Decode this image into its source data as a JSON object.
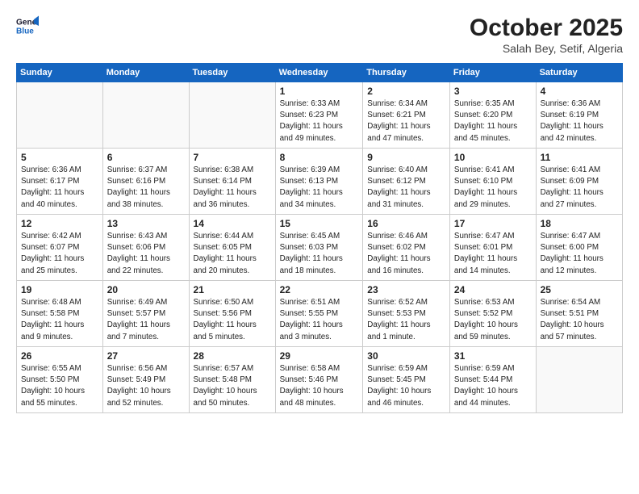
{
  "header": {
    "logo_line1": "General",
    "logo_line2": "Blue",
    "month": "October 2025",
    "location": "Salah Bey, Setif, Algeria"
  },
  "weekdays": [
    "Sunday",
    "Monday",
    "Tuesday",
    "Wednesday",
    "Thursday",
    "Friday",
    "Saturday"
  ],
  "weeks": [
    [
      {
        "day": "",
        "info": ""
      },
      {
        "day": "",
        "info": ""
      },
      {
        "day": "",
        "info": ""
      },
      {
        "day": "1",
        "info": "Sunrise: 6:33 AM\nSunset: 6:23 PM\nDaylight: 11 hours\nand 49 minutes."
      },
      {
        "day": "2",
        "info": "Sunrise: 6:34 AM\nSunset: 6:21 PM\nDaylight: 11 hours\nand 47 minutes."
      },
      {
        "day": "3",
        "info": "Sunrise: 6:35 AM\nSunset: 6:20 PM\nDaylight: 11 hours\nand 45 minutes."
      },
      {
        "day": "4",
        "info": "Sunrise: 6:36 AM\nSunset: 6:19 PM\nDaylight: 11 hours\nand 42 minutes."
      }
    ],
    [
      {
        "day": "5",
        "info": "Sunrise: 6:36 AM\nSunset: 6:17 PM\nDaylight: 11 hours\nand 40 minutes."
      },
      {
        "day": "6",
        "info": "Sunrise: 6:37 AM\nSunset: 6:16 PM\nDaylight: 11 hours\nand 38 minutes."
      },
      {
        "day": "7",
        "info": "Sunrise: 6:38 AM\nSunset: 6:14 PM\nDaylight: 11 hours\nand 36 minutes."
      },
      {
        "day": "8",
        "info": "Sunrise: 6:39 AM\nSunset: 6:13 PM\nDaylight: 11 hours\nand 34 minutes."
      },
      {
        "day": "9",
        "info": "Sunrise: 6:40 AM\nSunset: 6:12 PM\nDaylight: 11 hours\nand 31 minutes."
      },
      {
        "day": "10",
        "info": "Sunrise: 6:41 AM\nSunset: 6:10 PM\nDaylight: 11 hours\nand 29 minutes."
      },
      {
        "day": "11",
        "info": "Sunrise: 6:41 AM\nSunset: 6:09 PM\nDaylight: 11 hours\nand 27 minutes."
      }
    ],
    [
      {
        "day": "12",
        "info": "Sunrise: 6:42 AM\nSunset: 6:07 PM\nDaylight: 11 hours\nand 25 minutes."
      },
      {
        "day": "13",
        "info": "Sunrise: 6:43 AM\nSunset: 6:06 PM\nDaylight: 11 hours\nand 22 minutes."
      },
      {
        "day": "14",
        "info": "Sunrise: 6:44 AM\nSunset: 6:05 PM\nDaylight: 11 hours\nand 20 minutes."
      },
      {
        "day": "15",
        "info": "Sunrise: 6:45 AM\nSunset: 6:03 PM\nDaylight: 11 hours\nand 18 minutes."
      },
      {
        "day": "16",
        "info": "Sunrise: 6:46 AM\nSunset: 6:02 PM\nDaylight: 11 hours\nand 16 minutes."
      },
      {
        "day": "17",
        "info": "Sunrise: 6:47 AM\nSunset: 6:01 PM\nDaylight: 11 hours\nand 14 minutes."
      },
      {
        "day": "18",
        "info": "Sunrise: 6:47 AM\nSunset: 6:00 PM\nDaylight: 11 hours\nand 12 minutes."
      }
    ],
    [
      {
        "day": "19",
        "info": "Sunrise: 6:48 AM\nSunset: 5:58 PM\nDaylight: 11 hours\nand 9 minutes."
      },
      {
        "day": "20",
        "info": "Sunrise: 6:49 AM\nSunset: 5:57 PM\nDaylight: 11 hours\nand 7 minutes."
      },
      {
        "day": "21",
        "info": "Sunrise: 6:50 AM\nSunset: 5:56 PM\nDaylight: 11 hours\nand 5 minutes."
      },
      {
        "day": "22",
        "info": "Sunrise: 6:51 AM\nSunset: 5:55 PM\nDaylight: 11 hours\nand 3 minutes."
      },
      {
        "day": "23",
        "info": "Sunrise: 6:52 AM\nSunset: 5:53 PM\nDaylight: 11 hours\nand 1 minute."
      },
      {
        "day": "24",
        "info": "Sunrise: 6:53 AM\nSunset: 5:52 PM\nDaylight: 10 hours\nand 59 minutes."
      },
      {
        "day": "25",
        "info": "Sunrise: 6:54 AM\nSunset: 5:51 PM\nDaylight: 10 hours\nand 57 minutes."
      }
    ],
    [
      {
        "day": "26",
        "info": "Sunrise: 6:55 AM\nSunset: 5:50 PM\nDaylight: 10 hours\nand 55 minutes."
      },
      {
        "day": "27",
        "info": "Sunrise: 6:56 AM\nSunset: 5:49 PM\nDaylight: 10 hours\nand 52 minutes."
      },
      {
        "day": "28",
        "info": "Sunrise: 6:57 AM\nSunset: 5:48 PM\nDaylight: 10 hours\nand 50 minutes."
      },
      {
        "day": "29",
        "info": "Sunrise: 6:58 AM\nSunset: 5:46 PM\nDaylight: 10 hours\nand 48 minutes."
      },
      {
        "day": "30",
        "info": "Sunrise: 6:59 AM\nSunset: 5:45 PM\nDaylight: 10 hours\nand 46 minutes."
      },
      {
        "day": "31",
        "info": "Sunrise: 6:59 AM\nSunset: 5:44 PM\nDaylight: 10 hours\nand 44 minutes."
      },
      {
        "day": "",
        "info": ""
      }
    ]
  ]
}
